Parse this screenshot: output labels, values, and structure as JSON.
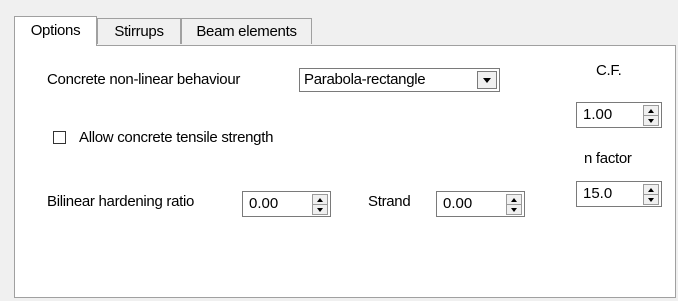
{
  "tabs": [
    {
      "label": "Options",
      "active": true
    },
    {
      "label": "Stirrups",
      "active": false
    },
    {
      "label": "Beam elements",
      "active": false
    }
  ],
  "options": {
    "concrete_behaviour_label": "Concrete non-linear behaviour",
    "concrete_behaviour_value": "Parabola-rectangle",
    "tensile_label": "Allow concrete tensile strength",
    "tensile_checked": false,
    "bilinear_label": "Bilinear hardening ratio",
    "bilinear_value": "0.00",
    "strand_label": "Strand",
    "strand_value": "0.00",
    "cf_label": "C.F.",
    "cf_value": "1.00",
    "nfactor_label": "n factor",
    "nfactor_value": "15.0"
  },
  "icons": {
    "dropdown": "chevron-down-icon",
    "spin_up": "arrow-up-icon",
    "spin_down": "arrow-down-icon"
  }
}
